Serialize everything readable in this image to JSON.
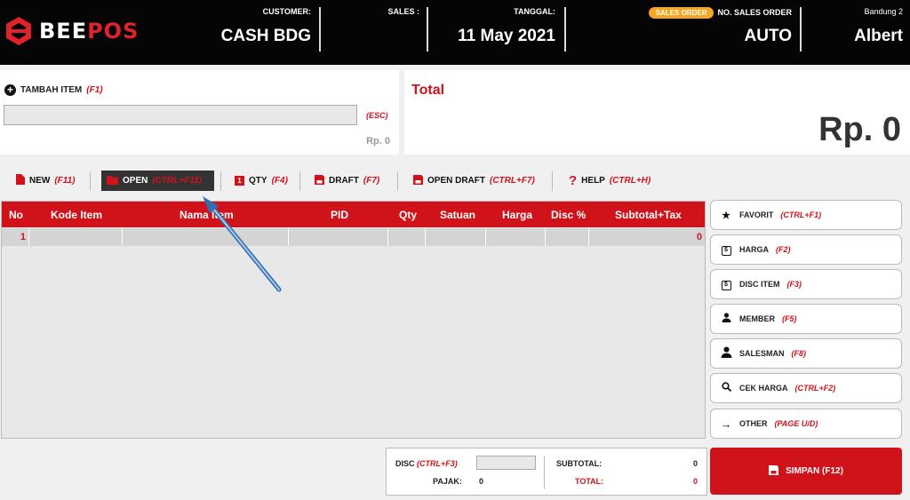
{
  "brand": {
    "part1": "BEE",
    "part2": "POS"
  },
  "header": {
    "customer_label": "CUSTOMER:",
    "customer_value": "CASH BDG",
    "sales_label": "SALES :",
    "sales_value": "",
    "date_label": "TANGGAL:",
    "date_value": "11 May 2021",
    "badge": "SALES ORDER",
    "so_label": "NO. SALES ORDER",
    "so_value": "AUTO",
    "branch_label": "Bandung 2",
    "user_value": "Albert"
  },
  "add_item": {
    "title": "TAMBAH ITEM",
    "shortcut": "(F1)",
    "input_value": "",
    "esc": "(ESC)",
    "price": "Rp. 0"
  },
  "total": {
    "label": "Total",
    "value": "Rp. 0"
  },
  "toolbar": [
    {
      "label": "NEW",
      "shortcut": "(F11)"
    },
    {
      "label": "OPEN",
      "shortcut": "(CTRL+F11)"
    },
    {
      "label": "QTY",
      "shortcut": "(F4)"
    },
    {
      "label": "DRAFT",
      "shortcut": "(F7)"
    },
    {
      "label": "OPEN DRAFT",
      "shortcut": "(CTRL+F7)"
    },
    {
      "label": "HELP",
      "shortcut": "(CTRL+H)"
    }
  ],
  "table": {
    "columns": [
      "No",
      "Kode Item",
      "Nama Item",
      "PID",
      "Qty",
      "Satuan",
      "Harga",
      "Disc %",
      "Subtotal+Tax"
    ],
    "rows": [
      {
        "no": "1",
        "subtotal": "0"
      }
    ]
  },
  "side_buttons": [
    {
      "label": "FAVORIT",
      "shortcut": "(CTRL+F1)"
    },
    {
      "label": "HARGA",
      "shortcut": "(F2)"
    },
    {
      "label": "DISC ITEM",
      "shortcut": "(F3)"
    },
    {
      "label": "MEMBER",
      "shortcut": "(F5)"
    },
    {
      "label": "SALESMAN",
      "shortcut": "(F8)"
    },
    {
      "label": "CEK HARGA",
      "shortcut": "(CTRL+F2)"
    },
    {
      "label": "OTHER",
      "shortcut": "(PAGE U/D)"
    }
  ],
  "summary": {
    "disc_label": "DISC",
    "disc_shortcut": "(CTRL+F3)",
    "pajak_label": "PAJAK:",
    "pajak_value": "0",
    "subtotal_label": "SUBTOTAL:",
    "subtotal_value": "0",
    "total_label": "TOTAL:",
    "total_value": "0"
  },
  "save": {
    "label": "SIMPAN (F12)"
  },
  "colors": {
    "accent": "#d0121b",
    "header_bg": "#050505",
    "badge": "#f5a623"
  },
  "icons": [
    "logo-icon",
    "plus-circle-icon",
    "file-icon",
    "folder-icon",
    "qty-icon",
    "save-icon",
    "question-icon",
    "star-icon",
    "dollar-icon",
    "user-icon",
    "search-icon",
    "arrow-right-icon"
  ]
}
